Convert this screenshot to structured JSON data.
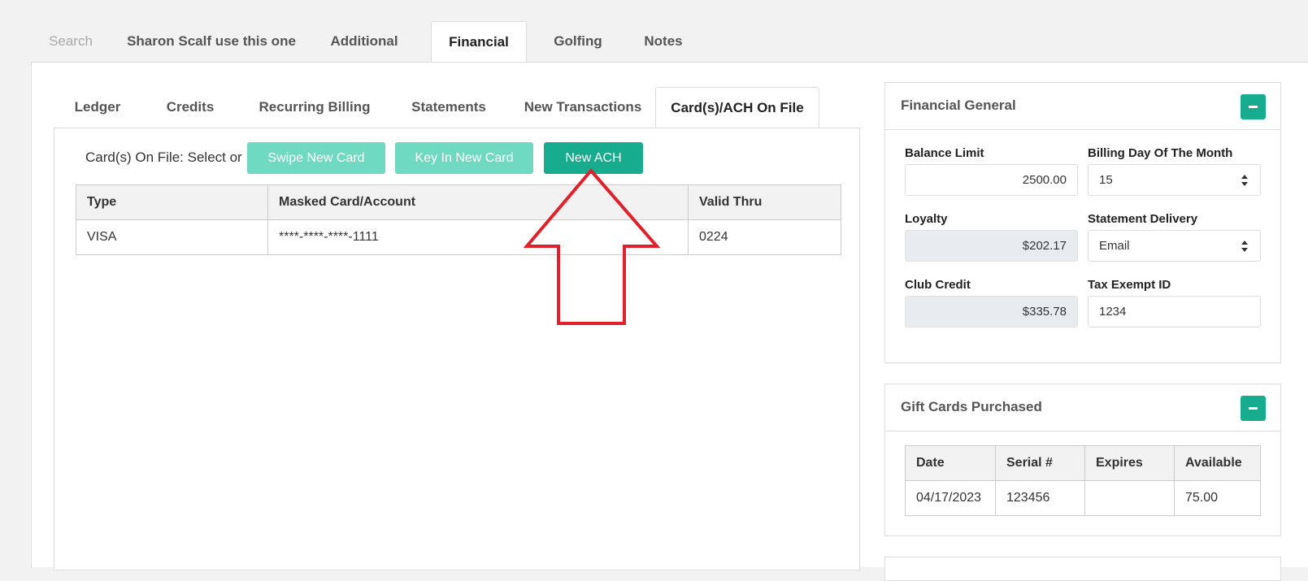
{
  "main_tabs": [
    {
      "label": "Search"
    },
    {
      "label": "Sharon Scalf use this one"
    },
    {
      "label": "Additional"
    },
    {
      "label": "Financial"
    },
    {
      "label": "Golfing"
    },
    {
      "label": "Notes"
    }
  ],
  "sub_tabs": [
    {
      "label": "Ledger"
    },
    {
      "label": "Credits"
    },
    {
      "label": "Recurring Billing"
    },
    {
      "label": "Statements"
    },
    {
      "label": "New Transactions"
    },
    {
      "label": "Card(s)/ACH On File"
    }
  ],
  "cards": {
    "label": "Card(s) On File: Select or",
    "swipe_button": "Swipe New Card",
    "keyin_button": "Key In New Card",
    "ach_button": "New ACH",
    "columns": [
      "Type",
      "Masked Card/Account",
      "Valid Thru"
    ],
    "rows": [
      {
        "type": "VISA",
        "masked": "****-****-****-1111",
        "valid_thru": "0224"
      }
    ]
  },
  "financial_general": {
    "title": "Financial General",
    "balance_limit_label": "Balance Limit",
    "balance_limit_value": "2500.00",
    "billing_day_label": "Billing Day Of The Month",
    "billing_day_value": "15",
    "loyalty_label": "Loyalty",
    "loyalty_value": "$202.17",
    "statement_delivery_label": "Statement Delivery",
    "statement_delivery_value": "Email",
    "club_credit_label": "Club Credit",
    "club_credit_value": "$335.78",
    "tax_exempt_label": "Tax Exempt ID",
    "tax_exempt_value": "1234"
  },
  "gift_cards": {
    "title": "Gift Cards Purchased",
    "columns": [
      "Date",
      "Serial #",
      "Expires",
      "Available"
    ],
    "rows": [
      {
        "date": "04/17/2023",
        "serial": "123456",
        "expires": "",
        "available": "75.00"
      }
    ]
  },
  "colors": {
    "accent": "#16ac8d",
    "accent_light": "#6fd9c1",
    "annotation_arrow": "#e0202a"
  }
}
